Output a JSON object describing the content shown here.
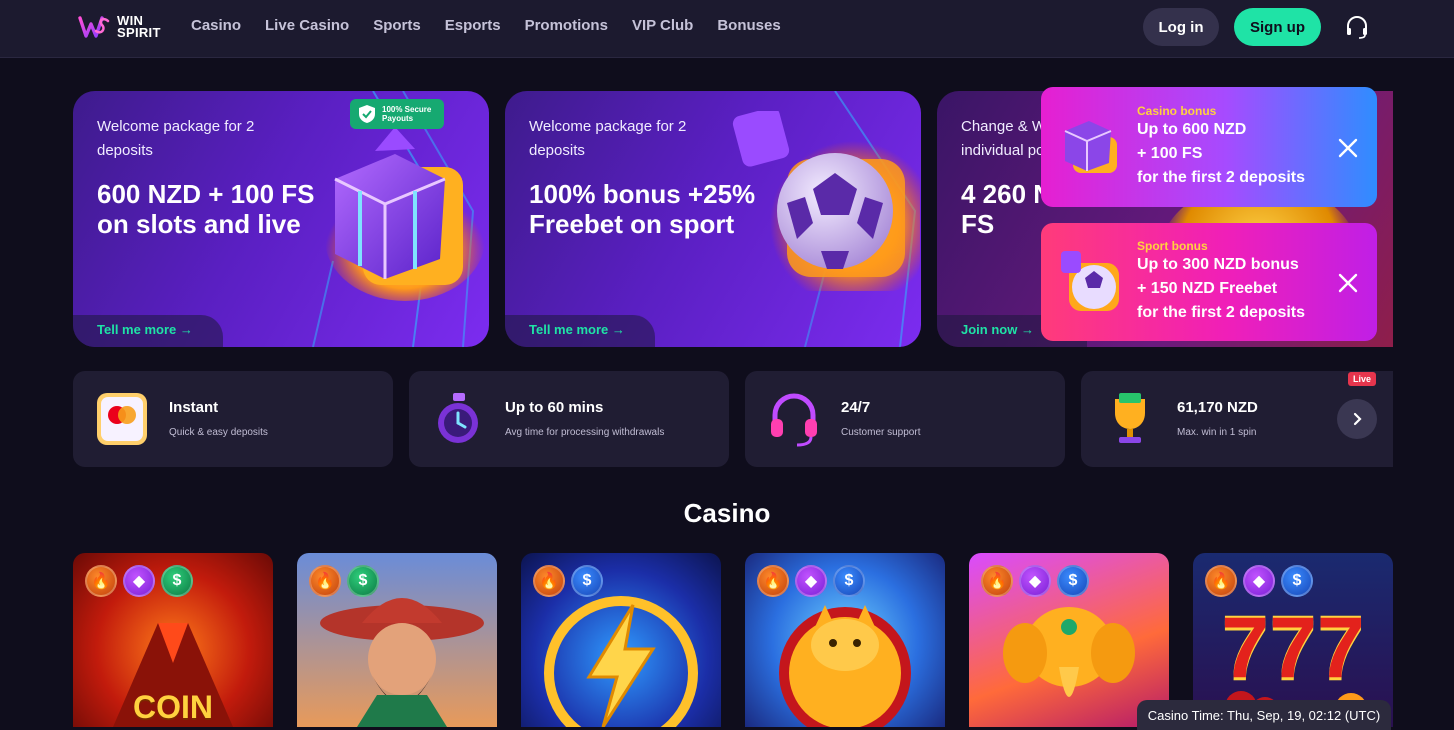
{
  "brand": {
    "line1": "WIN",
    "line2": "SPIRIT"
  },
  "nav": [
    "Casino",
    "Live Casino",
    "Sports",
    "Esports",
    "Promotions",
    "VIP Club",
    "Bonuses"
  ],
  "auth": {
    "login": "Log in",
    "signup": "Sign up"
  },
  "promos": [
    {
      "subtitle": "Welcome package for 2 deposits",
      "title": "600 NZD + 100 FS on slots and live",
      "cta": "Tell me more",
      "badge": "100% Secure Payouts"
    },
    {
      "subtitle": "Welcome package for 2 deposits",
      "title": "100% bonus +25% Freebet on sport",
      "cta": "Tell me more"
    },
    {
      "subtitle": "Change & Win with an individual pool",
      "title": "4 260 NZD + 640 FS",
      "cta": "Join now"
    }
  ],
  "popups": [
    {
      "tag": "Casino bonus",
      "lines": [
        "Up to 600 NZD",
        "+ 100 FS",
        "for the first 2 deposits"
      ]
    },
    {
      "tag": "Sport bonus",
      "lines": [
        "Up to 300 NZD bonus",
        "+ 150 NZD Freebet",
        "for the first 2 deposits"
      ]
    }
  ],
  "features": [
    {
      "title": "Instant",
      "subtitle": "Quick & easy deposits",
      "icon": "card-icon"
    },
    {
      "title": "Up to 60 mins",
      "subtitle": "Avg time for processing withdrawals",
      "icon": "stopwatch-icon"
    },
    {
      "title": "24/7",
      "subtitle": "Customer support",
      "icon": "headset-icon"
    },
    {
      "title": "61,170 NZD",
      "subtitle": "Max. win in 1 spin",
      "icon": "trophy-icon"
    }
  ],
  "live_badge": "Live",
  "section": {
    "casino": "Casino"
  },
  "games": [
    {
      "label": "COIN"
    },
    {
      "label": ""
    },
    {
      "label": ""
    },
    {
      "label": ""
    },
    {
      "label": ""
    },
    {
      "label": "777"
    }
  ],
  "casino_time": "Casino Time: Thu, Sep, 19, 02:12 (UTC)"
}
